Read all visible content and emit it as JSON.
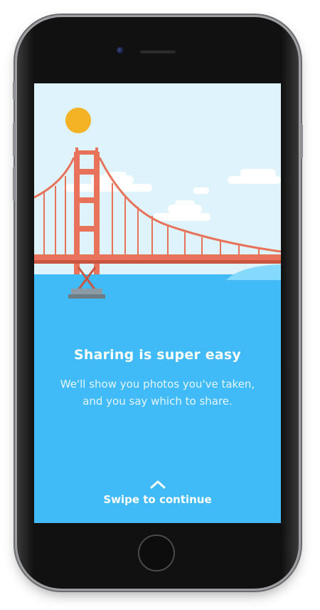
{
  "onboarding": {
    "title": "Sharing is super easy",
    "subtitle": "We'll show you photos you've taken, and you say which to share.",
    "swipe_label": "Swipe to continue",
    "swipe_icon": "chevron-up-icon"
  },
  "colors": {
    "sky": "#def3fb",
    "water": "#40bbf7",
    "sun": "#f4b325",
    "bridge": "#e8735a",
    "bridge_dark": "#c9553f",
    "cloud": "#ffffff",
    "text": "#ffffff"
  }
}
